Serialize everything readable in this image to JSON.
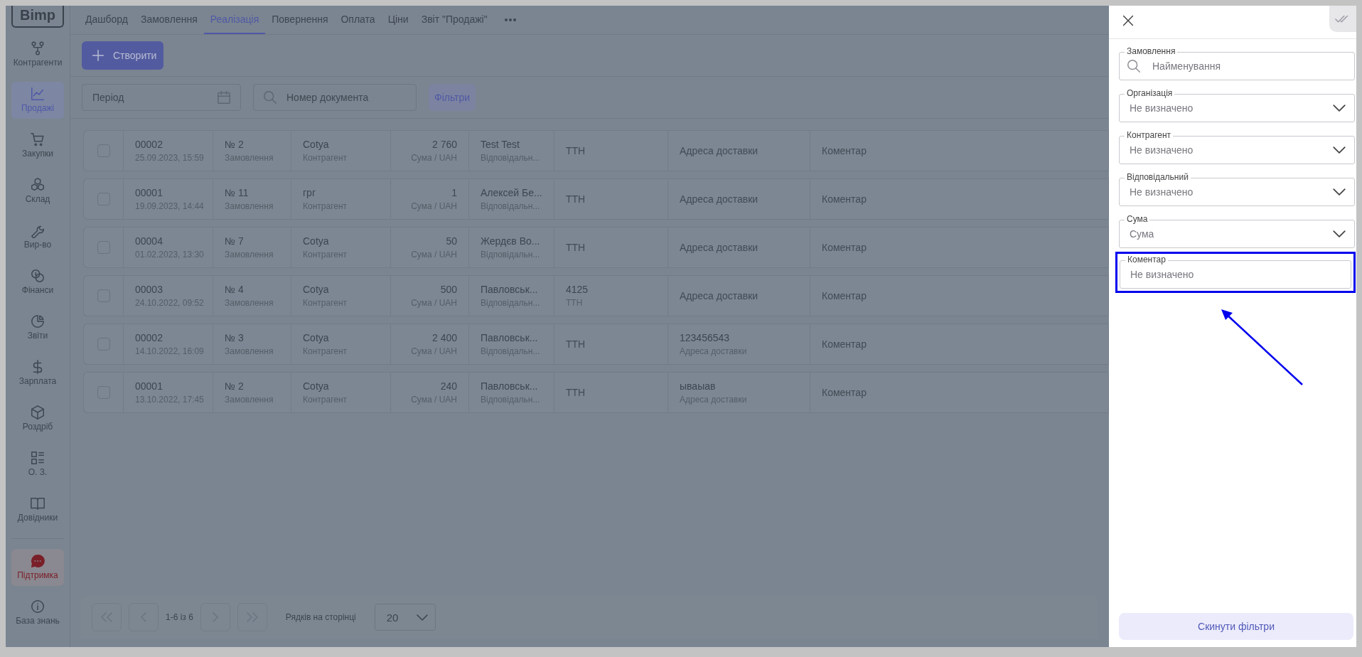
{
  "sidebar": {
    "logo": "Bimp",
    "items": [
      {
        "label": "Контрагенти",
        "selected": false
      },
      {
        "label": "Продажі",
        "selected": true
      },
      {
        "label": "Закупки",
        "selected": false
      },
      {
        "label": "Склад",
        "selected": false
      },
      {
        "label": "Вир-во",
        "selected": false
      },
      {
        "label": "Фінанси",
        "selected": false
      },
      {
        "label": "Звіти",
        "selected": false
      },
      {
        "label": "Зарплата",
        "selected": false
      },
      {
        "label": "Роздріб",
        "selected": false
      },
      {
        "label": "О. З.",
        "selected": false
      },
      {
        "label": "Довідники",
        "selected": false
      }
    ],
    "support": {
      "label": "Підтримка"
    },
    "knowledge": {
      "label": "База знань"
    }
  },
  "tabs": [
    {
      "label": "Дашборд",
      "selected": false
    },
    {
      "label": "Замовлення",
      "selected": false
    },
    {
      "label": "Реалізація",
      "selected": true
    },
    {
      "label": "Повернення",
      "selected": false
    },
    {
      "label": "Оплата",
      "selected": false
    },
    {
      "label": "Ціни",
      "selected": false
    },
    {
      "label": "Звіт \"Продажі\"",
      "selected": false
    }
  ],
  "create_button": "Створити",
  "toolbar": {
    "period": {
      "placeholder": "Період"
    },
    "search": {
      "placeholder": "Номер документа"
    },
    "filters_button": "Фільтри"
  },
  "table": {
    "rows": [
      {
        "checked": false,
        "cells": [
          {
            "value": "00002",
            "label": "25.09.2023, 15:59"
          },
          {
            "value": "№ 2",
            "label": "Замовлення"
          },
          {
            "value": "Cotya",
            "label": "Контрагент"
          },
          {
            "value": "2 760",
            "label": "Сума / UAH"
          },
          {
            "value": "Test Test",
            "label": "Відповідальн..."
          },
          {
            "label": "ТТН"
          },
          {
            "label": "Адреса доставки"
          },
          {
            "label": "Коментар"
          }
        ]
      },
      {
        "checked": false,
        "cells": [
          {
            "value": "00001",
            "label": "19.09.2023, 14:44"
          },
          {
            "value": "№ 11",
            "label": "Замовлення"
          },
          {
            "value": "грг",
            "label": "Контрагент"
          },
          {
            "value": "1",
            "label": "Сума / UAH"
          },
          {
            "value": "Алексей Бе...",
            "label": "Відповідальн..."
          },
          {
            "label": "ТТН"
          },
          {
            "label": "Адреса доставки"
          },
          {
            "label": "Коментар"
          }
        ]
      },
      {
        "checked": false,
        "cells": [
          {
            "value": "00004",
            "label": "01.02.2023, 13:30"
          },
          {
            "value": "№ 7",
            "label": "Замовлення"
          },
          {
            "value": "Cotya",
            "label": "Контрагент"
          },
          {
            "value": "50",
            "label": "Сума / UAH"
          },
          {
            "value": "Жердєв Во...",
            "label": "Відповідальн..."
          },
          {
            "label": "ТТН"
          },
          {
            "label": "Адреса доставки"
          },
          {
            "label": "Коментар"
          }
        ]
      },
      {
        "checked": false,
        "cells": [
          {
            "value": "00003",
            "label": "24.10.2022, 09:52"
          },
          {
            "value": "№ 4",
            "label": "Замовлення"
          },
          {
            "value": "Cotya",
            "label": "Контрагент"
          },
          {
            "value": "500",
            "label": "Сума / UAH"
          },
          {
            "value": "Павловськ...",
            "label": "Відповідальн..."
          },
          {
            "value": "4125",
            "label": "ТТН"
          },
          {
            "label": "Адреса доставки"
          },
          {
            "label": "Коментар"
          }
        ]
      },
      {
        "checked": false,
        "cells": [
          {
            "value": "00002",
            "label": "14.10.2022, 16:09"
          },
          {
            "value": "№ 3",
            "label": "Замовлення"
          },
          {
            "value": "Cotya",
            "label": "Контрагент"
          },
          {
            "value": "2 400",
            "label": "Сума / UAH"
          },
          {
            "value": "Павловськ...",
            "label": "Відповідальн..."
          },
          {
            "label": "ТТН"
          },
          {
            "value": "123456543",
            "label": "Адреса доставки"
          },
          {
            "label": "Коментар"
          }
        ]
      },
      {
        "checked": false,
        "cells": [
          {
            "value": "00001",
            "label": "13.10.2022, 17:45"
          },
          {
            "value": "№ 2",
            "label": "Замовлення"
          },
          {
            "value": "Cotya",
            "label": "Контрагент"
          },
          {
            "value": "240",
            "label": "Сума / UAH"
          },
          {
            "value": "Павловськ...",
            "label": "Відповідальн..."
          },
          {
            "label": "ТТН"
          },
          {
            "value": "ываыав",
            "label": "Адреса доставки"
          },
          {
            "label": "Коментар"
          }
        ]
      }
    ]
  },
  "pagination": {
    "range": "1-6 із 6",
    "rows_label": "Рядків на сторінці",
    "page_size": "20"
  },
  "filter_panel": {
    "fields": [
      {
        "kind": "search",
        "label": "Замовлення",
        "placeholder": "Найменування",
        "highlighted": false
      },
      {
        "kind": "select",
        "label": "Організація",
        "placeholder": "Не визначено",
        "highlighted": false
      },
      {
        "kind": "select",
        "label": "Контрагент",
        "placeholder": "Не визначено",
        "highlighted": false
      },
      {
        "kind": "select",
        "label": "Відповідальний",
        "placeholder": "Не визначено",
        "highlighted": false
      },
      {
        "kind": "select",
        "label": "Сума",
        "placeholder": "Сума",
        "highlighted": false
      },
      {
        "kind": "text",
        "label": "Коментар",
        "placeholder": "Не визначено",
        "highlighted": true
      }
    ],
    "reset_button": "Скинути фільтри"
  }
}
